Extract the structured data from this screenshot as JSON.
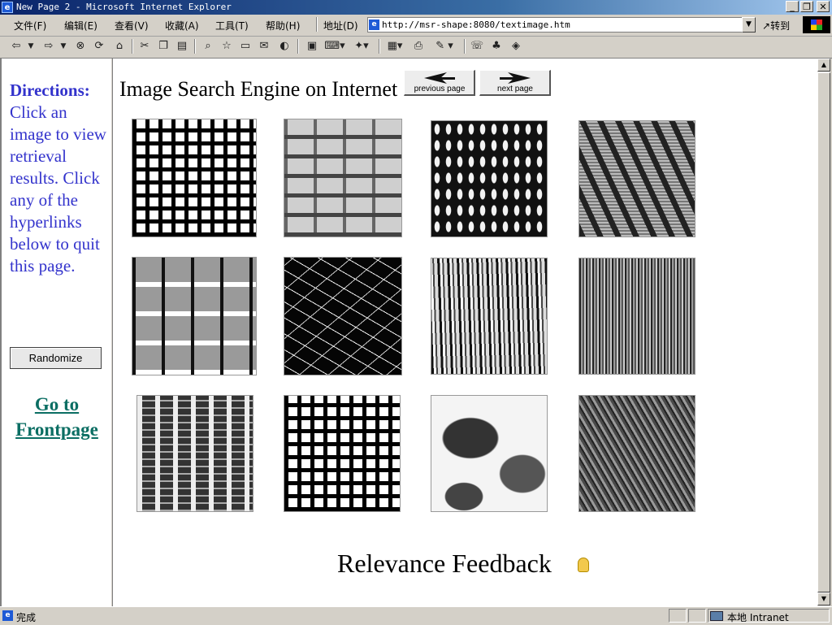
{
  "window": {
    "title": "New Page 2 - Microsoft Internet Explorer",
    "controls": {
      "minimize": "_",
      "restore": "❐",
      "close": "✕"
    }
  },
  "menubar": {
    "items": [
      {
        "label": "文件(F)"
      },
      {
        "label": "编辑(E)"
      },
      {
        "label": "查看(V)"
      },
      {
        "label": "收藏(A)"
      },
      {
        "label": "工具(T)"
      },
      {
        "label": "帮助(H)"
      }
    ],
    "address_label": "地址(D)",
    "address_value": "http://msr-shape:8080/textimage.htm",
    "go_label": "转到"
  },
  "toolbar": {
    "icons": [
      "back-icon",
      "dropdown-arrow-icon",
      "forward-icon",
      "dropdown-arrow-icon",
      "stop-icon",
      "refresh-icon",
      "home-icon",
      "cut-icon",
      "copy-icon",
      "paste-icon",
      "search-icon",
      "favorites-icon",
      "history-icon",
      "mail-icon",
      "print-icon",
      "edit-icon",
      "discuss-icon",
      "messenger-icon"
    ]
  },
  "sidebar": {
    "directions_heading": "Directions:",
    "directions_text": "Click an image to view retrieval results. Click any of the hyperlinks below to quit this page.",
    "randomize_label": "Randomize",
    "frontpage_link": "Go to Frontpage"
  },
  "main": {
    "title": "Image Search Engine on Internet",
    "prev_button": "previous page",
    "next_button": "next page",
    "thumbnails": [
      {
        "texture": "grid"
      },
      {
        "texture": "brick"
      },
      {
        "texture": "mesh"
      },
      {
        "texture": "noise"
      },
      {
        "texture": "tiles"
      },
      {
        "texture": "fibers"
      },
      {
        "texture": "strands"
      },
      {
        "texture": "bark"
      },
      {
        "texture": "cloth"
      },
      {
        "texture": "grid"
      },
      {
        "texture": "stones"
      },
      {
        "texture": "wood"
      }
    ],
    "feedback_label": "Relevance Feedback"
  },
  "statusbar": {
    "status_text": "完成",
    "zone_text": "本地 Intranet"
  },
  "colors": {
    "directions_text": "#3333cc",
    "link": "#0b6e63",
    "titlebar_start": "#0a246a",
    "titlebar_end": "#a6caf0"
  }
}
